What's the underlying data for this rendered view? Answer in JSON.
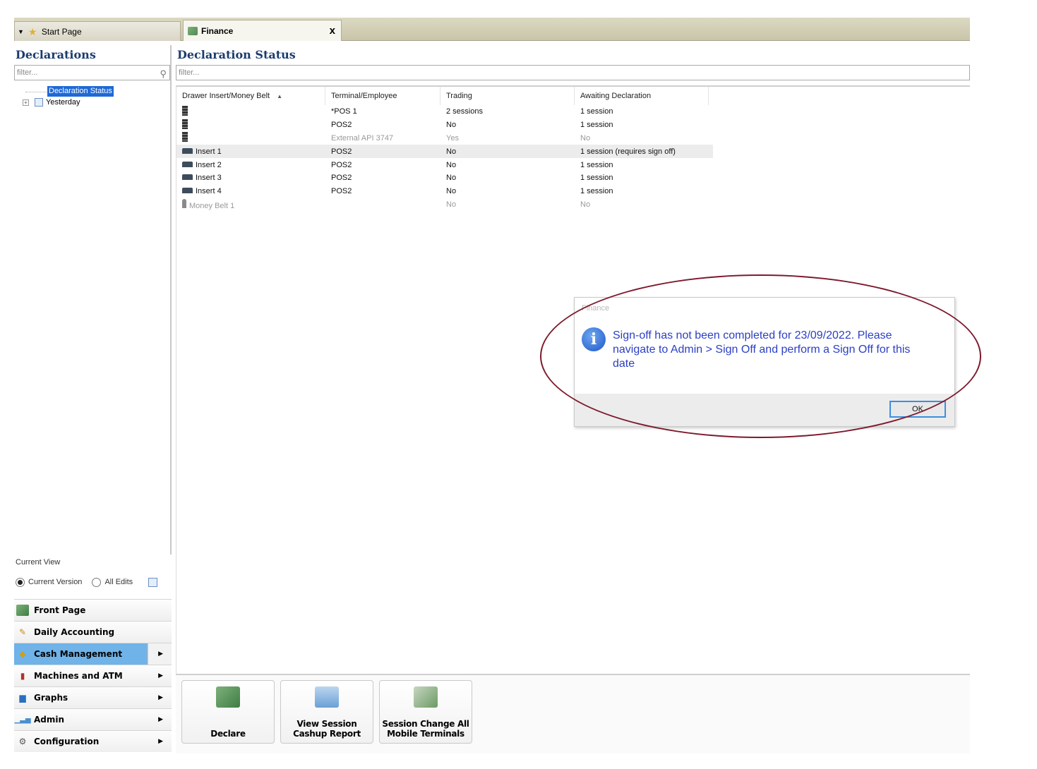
{
  "tabs": {
    "start_page": "Start Page",
    "finance": "Finance",
    "close_symbol": "x"
  },
  "left": {
    "title": "Declarations",
    "filter_placeholder": "filter...",
    "tree": {
      "selected": "Declaration Status",
      "yesterday": "Yesterday"
    },
    "current_view": {
      "label": "Current View",
      "option_current": "Current Version",
      "option_all": "All Edits",
      "selected": "Current Version"
    },
    "nav": [
      {
        "label": "Front Page",
        "icon": "finance-icon",
        "has_submenu": false
      },
      {
        "label": "Daily Accounting",
        "icon": "accounting-icon",
        "has_submenu": false
      },
      {
        "label": "Cash Management",
        "icon": "cash-icon",
        "has_submenu": true,
        "active": true
      },
      {
        "label": "Machines and ATM",
        "icon": "machine-icon",
        "has_submenu": true
      },
      {
        "label": "Graphs",
        "icon": "graph-icon",
        "has_submenu": true
      },
      {
        "label": "Admin",
        "icon": "admin-icon",
        "has_submenu": true
      },
      {
        "label": "Configuration",
        "icon": "gear-icon",
        "has_submenu": true
      }
    ]
  },
  "main": {
    "title": "Declaration Status",
    "filter_placeholder": "filter...",
    "columns": [
      "Drawer Insert/Money Belt",
      "Terminal/Employee",
      "Trading",
      "Awaiting Declaration"
    ],
    "rows": [
      {
        "icon": "stack-icon",
        "name": "",
        "terminal": "*POS 1",
        "trading": "2 sessions",
        "awaiting": "1 session",
        "dim": false
      },
      {
        "icon": "stack-icon",
        "name": "",
        "terminal": "POS2",
        "trading": "No",
        "awaiting": "1 session",
        "dim": false
      },
      {
        "icon": "stack-icon",
        "name": "",
        "terminal": "External API 3747",
        "trading": "Yes",
        "awaiting": "No",
        "dim": true
      },
      {
        "icon": "drawer-icon",
        "name": "Insert 1",
        "terminal": "POS2",
        "trading": "No",
        "awaiting": "1 session (requires sign off)",
        "dim": false,
        "selected": true
      },
      {
        "icon": "drawer-icon",
        "name": "Insert 2",
        "terminal": "POS2",
        "trading": "No",
        "awaiting": "1 session",
        "dim": false
      },
      {
        "icon": "drawer-icon",
        "name": "Insert 3",
        "terminal": "POS2",
        "trading": "No",
        "awaiting": "1 session",
        "dim": false
      },
      {
        "icon": "drawer-icon",
        "name": "Insert 4",
        "terminal": "POS2",
        "trading": "No",
        "awaiting": "1 session",
        "dim": false
      },
      {
        "icon": "person-icon",
        "name": "Money Belt 1",
        "terminal": "",
        "trading": "No",
        "awaiting": "No",
        "dim": true
      }
    ],
    "actions": {
      "declare": "Declare",
      "cashup": "View Session Cashup Report",
      "change": "Session Change All Mobile Terminals"
    }
  },
  "dialog": {
    "title": "Finance",
    "message": "Sign-off has not been completed for 23/09/2022. Please navigate to Admin > Sign Off and perform a Sign Off for this date",
    "ok_label": "OK"
  },
  "colors": {
    "title_blue": "#1c3c6e",
    "selection_blue": "#1f69d6",
    "nav_active": "#6fb3e9",
    "message_text": "#2b3fc4",
    "annotation": "#7d1a2c"
  }
}
